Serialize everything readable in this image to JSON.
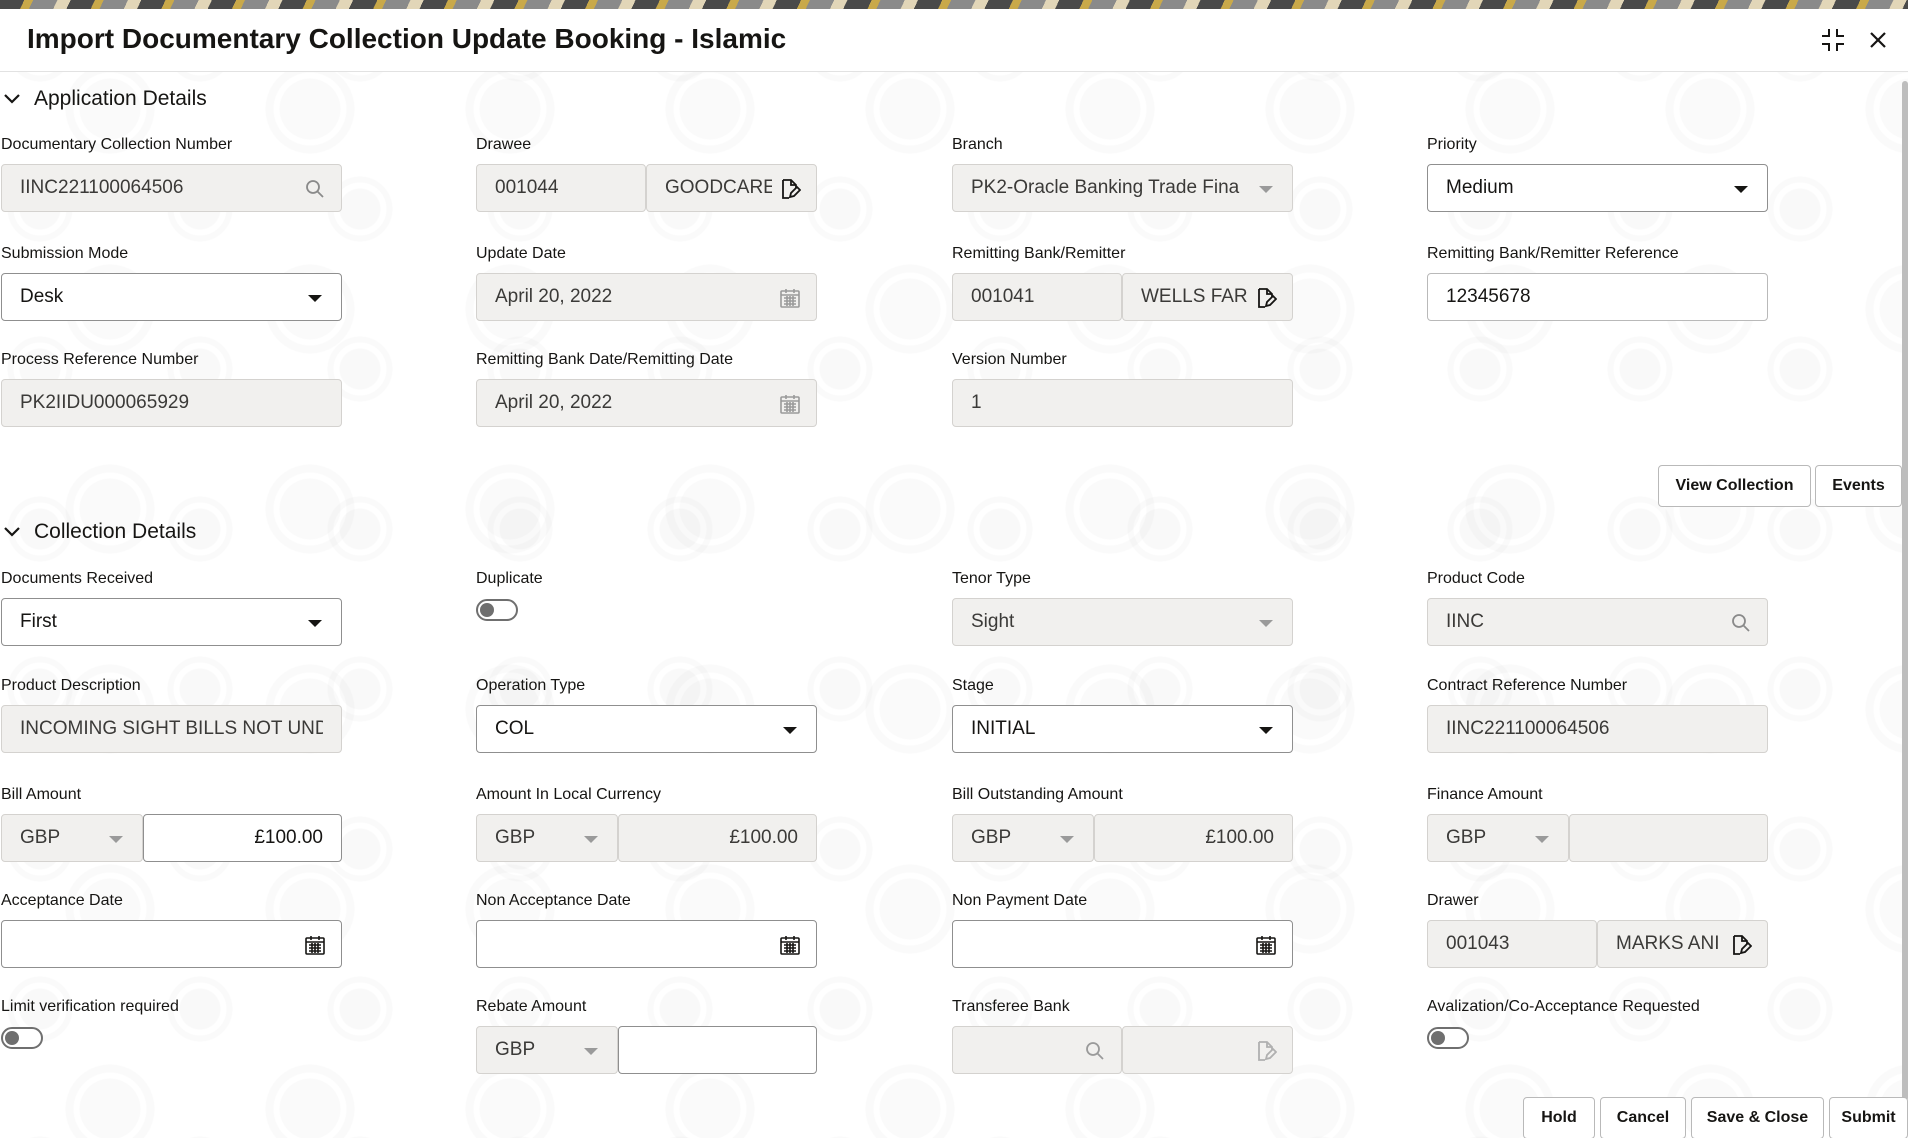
{
  "window": {
    "title": "Import Documentary Collection Update Booking - Islamic",
    "minimize_icon": "compress-icon",
    "close_icon": "close-icon"
  },
  "application_details": {
    "title": "Application Details",
    "documentary_collection_number": {
      "label": "Documentary Collection Number",
      "value": "IINC221100064506"
    },
    "drawee": {
      "label": "Drawee",
      "code": "001044",
      "name": "GOODCARE"
    },
    "branch": {
      "label": "Branch",
      "value": "PK2-Oracle Banking Trade Fina"
    },
    "priority": {
      "label": "Priority",
      "value": "Medium"
    },
    "submission_mode": {
      "label": "Submission Mode",
      "value": "Desk"
    },
    "update_date": {
      "label": "Update Date",
      "value": "April 20, 2022"
    },
    "remitting_bank": {
      "label": "Remitting Bank/Remitter",
      "code": "001041",
      "name": "WELLS FAR"
    },
    "remitting_bank_reference": {
      "label": "Remitting Bank/Remitter Reference",
      "value": "12345678"
    },
    "process_reference_number": {
      "label": "Process Reference Number",
      "value": "PK2IIDU000065929"
    },
    "remitting_date": {
      "label": "Remitting Bank Date/Remitting Date",
      "value": "April 20, 2022"
    },
    "version_number": {
      "label": "Version Number",
      "value": "1"
    },
    "view_collection_label": "View Collection",
    "events_label": "Events"
  },
  "collection_details": {
    "title": "Collection Details",
    "documents_received": {
      "label": "Documents Received",
      "value": "First"
    },
    "duplicate": {
      "label": "Duplicate",
      "on": false
    },
    "tenor_type": {
      "label": "Tenor Type",
      "value": "Sight"
    },
    "product_code": {
      "label": "Product Code",
      "value": "IINC"
    },
    "product_description": {
      "label": "Product Description",
      "value": "INCOMING SIGHT BILLS NOT UNDE"
    },
    "operation_type": {
      "label": "Operation Type",
      "value": "COL"
    },
    "stage": {
      "label": "Stage",
      "value": "INITIAL"
    },
    "contract_reference_number": {
      "label": "Contract Reference Number",
      "value": "IINC221100064506"
    },
    "bill_amount": {
      "label": "Bill Amount",
      "currency": "GBP",
      "amount": "£100.00"
    },
    "amount_local": {
      "label": "Amount In Local Currency",
      "currency": "GBP",
      "amount": "£100.00"
    },
    "bill_outstanding": {
      "label": "Bill Outstanding Amount",
      "currency": "GBP",
      "amount": "£100.00"
    },
    "finance_amount": {
      "label": "Finance Amount",
      "currency": "GBP",
      "amount": ""
    },
    "acceptance_date": {
      "label": "Acceptance Date",
      "value": ""
    },
    "non_acceptance_date": {
      "label": "Non Acceptance Date",
      "value": ""
    },
    "non_payment_date": {
      "label": "Non Payment Date",
      "value": ""
    },
    "drawer": {
      "label": "Drawer",
      "code": "001043",
      "name": "MARKS ANI"
    },
    "limit_verification": {
      "label": "Limit verification required",
      "on": false
    },
    "rebate_amount": {
      "label": "Rebate Amount",
      "currency": "GBP",
      "amount": ""
    },
    "transferee_bank": {
      "label": "Transferee Bank",
      "code": "",
      "name": ""
    },
    "avalization": {
      "label": "Avalization/Co-Acceptance Requested",
      "on": false
    }
  },
  "footer": {
    "hold_label": "Hold",
    "cancel_label": "Cancel",
    "save_close_label": "Save & Close",
    "submit_label": "Submit"
  }
}
